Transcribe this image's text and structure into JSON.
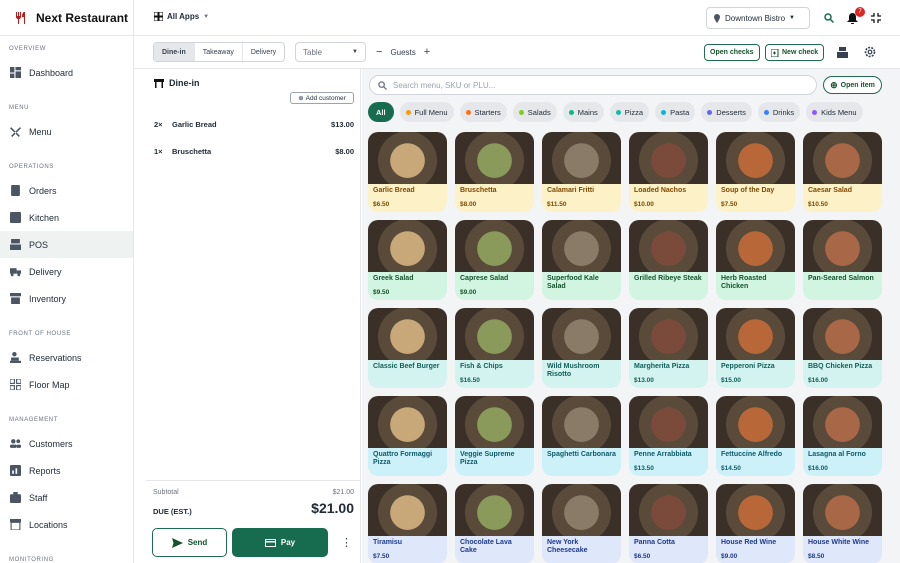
{
  "brand": {
    "name": "Next Restaurant"
  },
  "colors": {
    "accent": "#176b4f",
    "badge": "#dc2626"
  },
  "sidebar": {
    "sections": [
      "OVERVIEW",
      "MENU",
      "OPERATIONS",
      "FRONT OF HOUSE",
      "MANAGEMENT",
      "MONITORING"
    ],
    "items": [
      {
        "label": "Dashboard",
        "icon": "dashboard-icon"
      },
      {
        "label": "Menu",
        "icon": "utensils-icon"
      },
      {
        "label": "Orders",
        "icon": "orders-icon"
      },
      {
        "label": "Kitchen",
        "icon": "kitchen-icon"
      },
      {
        "label": "POS",
        "icon": "pos-icon",
        "active": true
      },
      {
        "label": "Delivery",
        "icon": "truck-icon"
      },
      {
        "label": "Inventory",
        "icon": "inventory-icon"
      },
      {
        "label": "Reservations",
        "icon": "reservations-icon"
      },
      {
        "label": "Floor Map",
        "icon": "floor-map-icon"
      },
      {
        "label": "Customers",
        "icon": "customers-icon"
      },
      {
        "label": "Reports",
        "icon": "reports-icon"
      },
      {
        "label": "Staff",
        "icon": "staff-icon"
      },
      {
        "label": "Locations",
        "icon": "locations-icon"
      }
    ]
  },
  "topbar": {
    "all_apps": "All Apps",
    "location": "Downtown Bistro",
    "notifications": "7"
  },
  "toolbar": {
    "tabs": [
      "Dine-in",
      "Takeaway",
      "Delivery"
    ],
    "table_placeholder": "Table",
    "guests_label": "Guests",
    "open_checks": "Open checks",
    "new_check": "New check"
  },
  "order": {
    "title": "Dine-in",
    "add_customer": "Add customer",
    "lines": [
      {
        "qty": "2×",
        "name": "Garlic Bread",
        "price": "$13.00"
      },
      {
        "qty": "1×",
        "name": "Bruschetta",
        "price": "$8.00"
      }
    ],
    "subtotal_label": "Subtotal",
    "subtotal": "$21.00",
    "due_label": "DUE (EST.)",
    "due": "$21.00",
    "send": "Send",
    "pay": "Pay"
  },
  "menu": {
    "search_placeholder": "Search menu, SKU or PLU...",
    "open_item": "Open item",
    "categories": [
      {
        "label": "All"
      },
      {
        "label": "Full Menu",
        "dot": "#f59e0b"
      },
      {
        "label": "Starters",
        "dot": "#f97316"
      },
      {
        "label": "Salads",
        "dot": "#84cc16"
      },
      {
        "label": "Mains",
        "dot": "#10b981"
      },
      {
        "label": "Pizza",
        "dot": "#14b8a6"
      },
      {
        "label": "Pasta",
        "dot": "#06b6d4"
      },
      {
        "label": "Desserts",
        "dot": "#6366f1"
      },
      {
        "label": "Drinks",
        "dot": "#3b82f6"
      },
      {
        "label": "Kids Menu",
        "dot": "#8b5cf6"
      }
    ],
    "items": [
      {
        "name": "Garlic Bread",
        "price": "$6.50"
      },
      {
        "name": "Bruschetta",
        "price": "$8.00"
      },
      {
        "name": "Calamari Fritti",
        "price": "$11.50"
      },
      {
        "name": "Loaded Nachos",
        "price": "$10.00"
      },
      {
        "name": "Soup of the Day",
        "price": "$7.50"
      },
      {
        "name": "Caesar Salad",
        "price": "$10.50"
      },
      {
        "name": "Greek Salad",
        "price": "$9.50"
      },
      {
        "name": "Caprese Salad",
        "price": "$9.00"
      },
      {
        "name": "Superfood Kale Salad",
        "price": ""
      },
      {
        "name": "Grilled Ribeye Steak",
        "price": ""
      },
      {
        "name": "Herb Roasted Chicken",
        "price": ""
      },
      {
        "name": "Pan-Seared Salmon",
        "price": ""
      },
      {
        "name": "Classic Beef Burger",
        "price": ""
      },
      {
        "name": "Fish & Chips",
        "price": "$16.50"
      },
      {
        "name": "Wild Mushroom Risotto",
        "price": ""
      },
      {
        "name": "Margherita Pizza",
        "price": "$13.00"
      },
      {
        "name": "Pepperoni Pizza",
        "price": "$15.00"
      },
      {
        "name": "BBQ Chicken Pizza",
        "price": "$16.00"
      },
      {
        "name": "Quattro Formaggi Pizza",
        "price": ""
      },
      {
        "name": "Veggie Supreme Pizza",
        "price": ""
      },
      {
        "name": "Spaghetti Carbonara",
        "price": ""
      },
      {
        "name": "Penne Arrabbiata",
        "price": "$13.50"
      },
      {
        "name": "Fettuccine Alfredo",
        "price": "$14.50"
      },
      {
        "name": "Lasagna al Forno",
        "price": "$16.00"
      },
      {
        "name": "Tiramisu",
        "price": "$7.50"
      },
      {
        "name": "Chocolate Lava Cake",
        "price": ""
      },
      {
        "name": "New York Cheesecake",
        "price": ""
      },
      {
        "name": "Panna Cotta",
        "price": "$6.50"
      },
      {
        "name": "House Red Wine",
        "price": "$9.00"
      },
      {
        "name": "House White Wine",
        "price": "$8.50"
      }
    ]
  }
}
